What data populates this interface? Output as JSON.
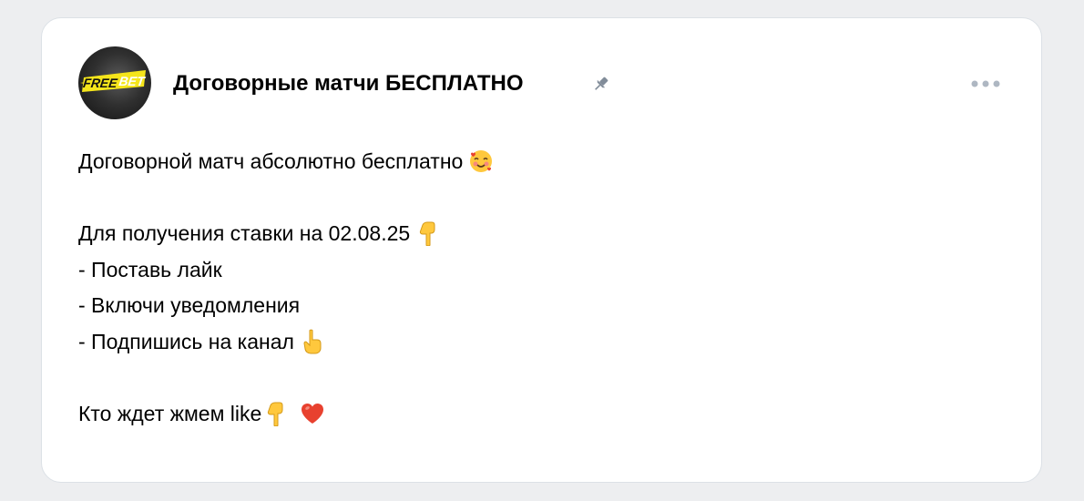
{
  "post": {
    "group_name": "Договорные матчи БЕСПЛАТНО",
    "avatar_text": "FREE BET",
    "pinned": true,
    "more_icon": "more-horizontal-icon",
    "pin_icon": "pin-icon",
    "lines": [
      {
        "text": "Договорной матч абсолютно бесплатно",
        "emoji": "smiling-face-with-hearts-icon"
      },
      {
        "text": "",
        "emoji": ""
      },
      {
        "text": "Для получения ставки на 02.08.25",
        "emoji": "pointing-down-icon"
      },
      {
        "text": "- Поставь лайк",
        "emoji": ""
      },
      {
        "text": "- Включи уведомления",
        "emoji": ""
      },
      {
        "text": "- Подпишись на канал",
        "emoji": "pointing-up-icon"
      },
      {
        "text": "",
        "emoji": ""
      },
      {
        "text": "Кто ждет жмем like",
        "emoji": "pointing-down-icon"
      }
    ],
    "last_line_extra_emoji": "red-heart-icon"
  },
  "colors": {
    "background": "#edeef0",
    "card": "#ffffff",
    "text": "#000000",
    "icon_gray": "#99a2ad",
    "emoji_yellow": "#ffc83d",
    "heart_red": "#e8412f",
    "avatar_yellow": "#f5e51b"
  }
}
